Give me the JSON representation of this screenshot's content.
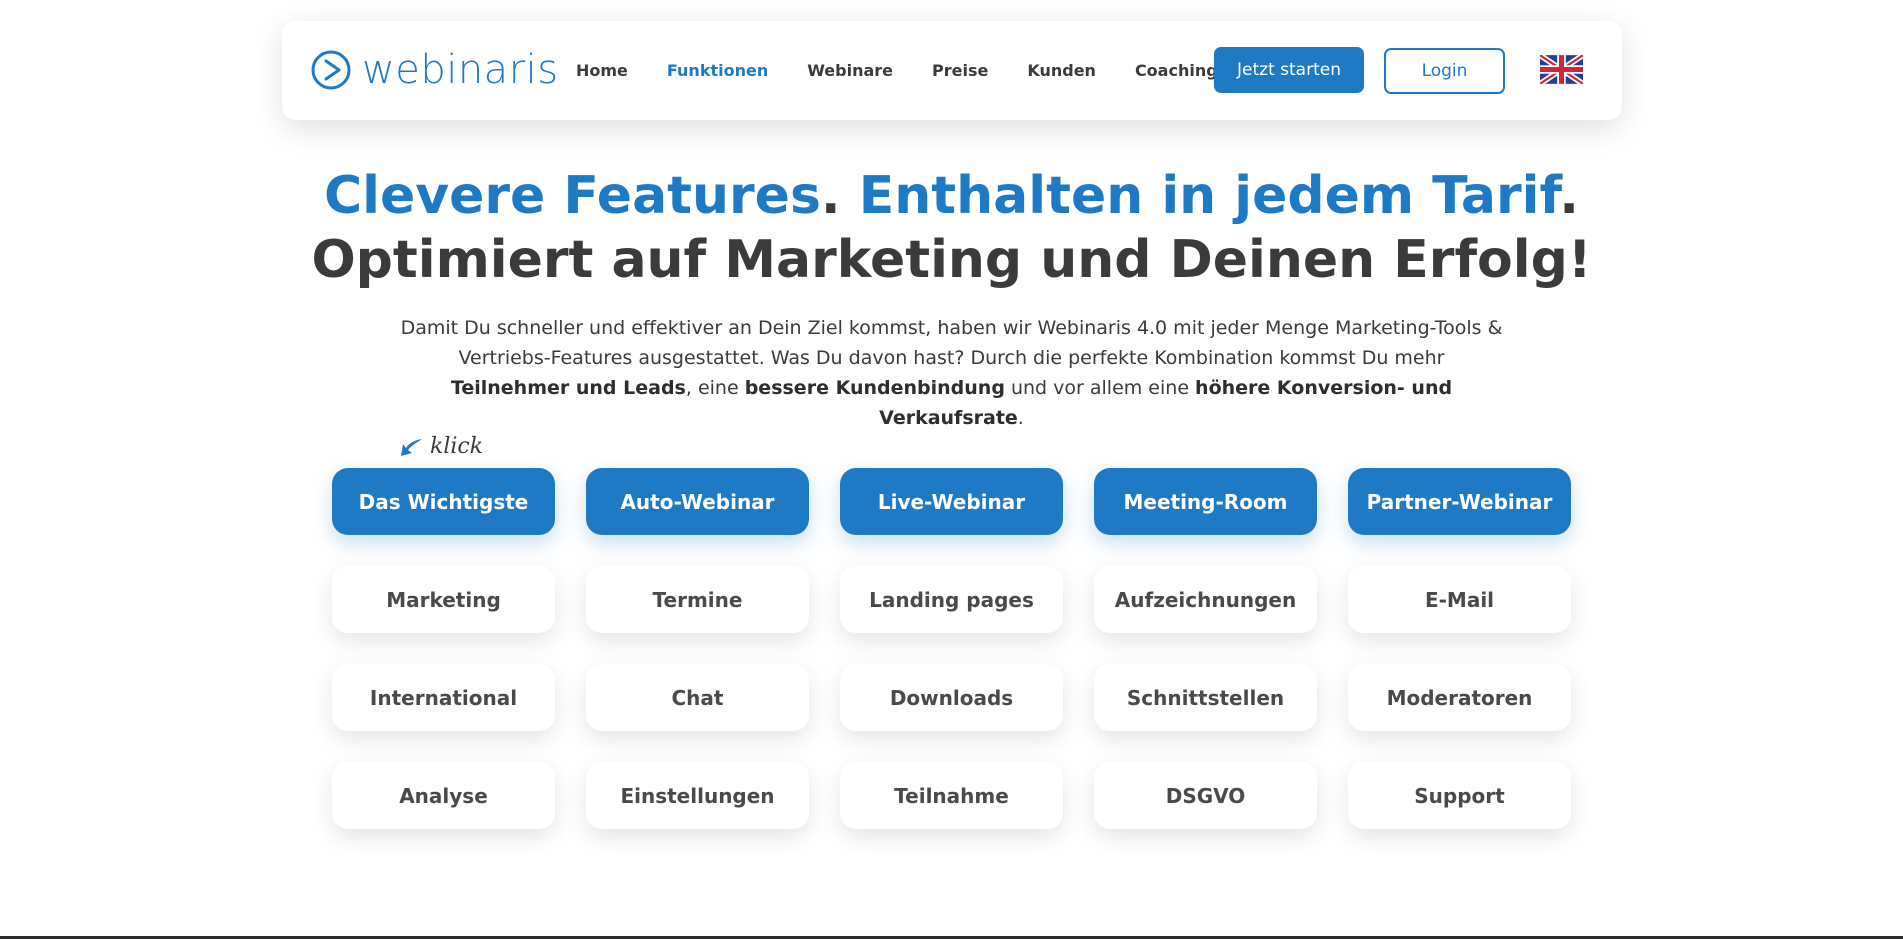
{
  "nav": {
    "logo_text": "webinaris",
    "links": [
      {
        "label": "Home",
        "active": false
      },
      {
        "label": "Funktionen",
        "active": true
      },
      {
        "label": "Webinare",
        "active": false
      },
      {
        "label": "Preise",
        "active": false
      },
      {
        "label": "Kunden",
        "active": false
      },
      {
        "label": "Coaching",
        "active": false
      }
    ],
    "start_label": "Jetzt starten",
    "login_label": "Login",
    "language_icon": "uk-flag-icon"
  },
  "hero": {
    "line1_part1": "Clevere Features",
    "line1_sep1": ". ",
    "line1_part2": "Enthalten in jedem Tarif",
    "line1_sep2": ".",
    "line2": "Optimiert auf Marketing und Deinen Erfolg!",
    "intro_1": "Damit Du schneller und effektiver an Dein Ziel kommst, haben wir Webinaris 4.0 mit jeder Menge Marketing-Tools & Vertriebs-Features ausgestattet. Was Du davon hast? Durch die perfekte Kombination kommst Du mehr ",
    "intro_b1": "Teilnehmer und Leads",
    "intro_2": ", eine ",
    "intro_b2": "bessere Kundenbindung",
    "intro_3": " und vor allem eine ",
    "intro_b3": "höhere Konversion- und Verkaufsrate",
    "intro_4": "."
  },
  "klick_label": "klick",
  "features": [
    {
      "label": "Das Wichtigste",
      "primary": true
    },
    {
      "label": "Auto-Webinar",
      "primary": true
    },
    {
      "label": "Live-Webinar",
      "primary": true
    },
    {
      "label": "Meeting-Room",
      "primary": true
    },
    {
      "label": "Partner-Webinar",
      "primary": true
    },
    {
      "label": "Marketing",
      "primary": false
    },
    {
      "label": "Termine",
      "primary": false
    },
    {
      "label": "Landing pages",
      "primary": false
    },
    {
      "label": "Aufzeichnungen",
      "primary": false
    },
    {
      "label": "E-Mail",
      "primary": false
    },
    {
      "label": "International",
      "primary": false
    },
    {
      "label": "Chat",
      "primary": false
    },
    {
      "label": "Downloads",
      "primary": false
    },
    {
      "label": "Schnittstellen",
      "primary": false
    },
    {
      "label": "Moderatoren",
      "primary": false
    },
    {
      "label": "Analyse",
      "primary": false
    },
    {
      "label": "Einstellungen",
      "primary": false
    },
    {
      "label": "Teilnahme",
      "primary": false
    },
    {
      "label": "DSGVO",
      "primary": false
    },
    {
      "label": "Support",
      "primary": false
    }
  ],
  "colors": {
    "brand": "#1f7ac6",
    "text": "#3b3b3b"
  }
}
